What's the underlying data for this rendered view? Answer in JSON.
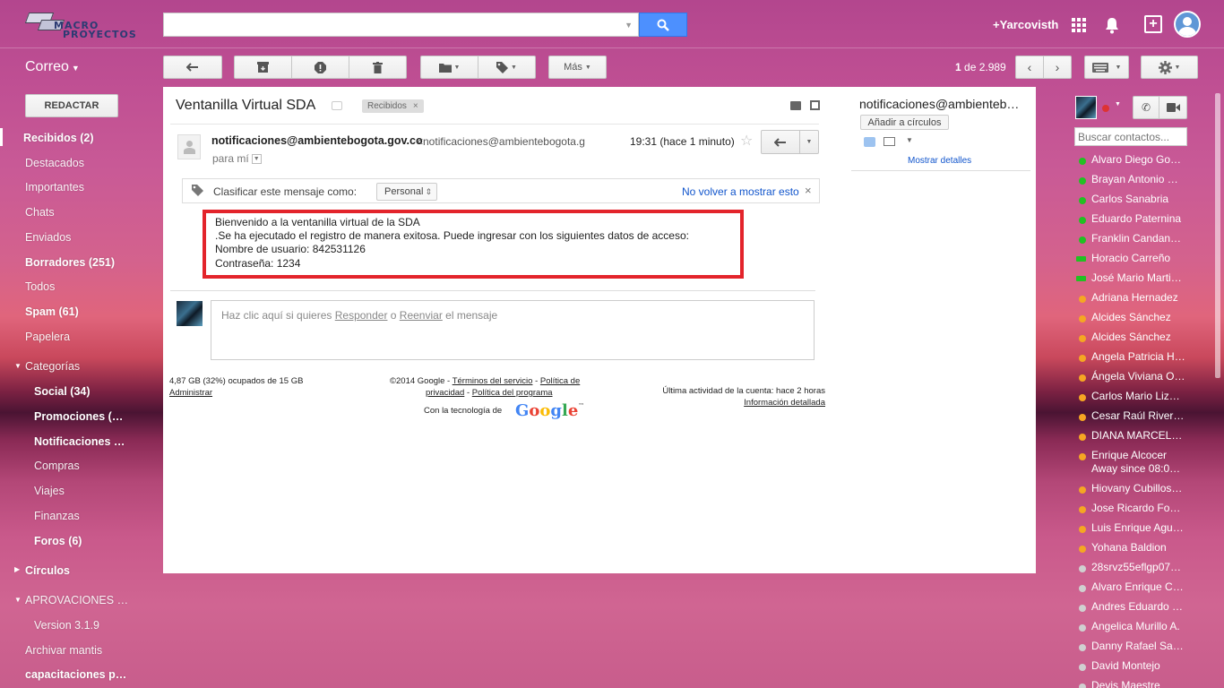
{
  "header": {
    "logo_line1": "MACRO",
    "logo_line2": "PROYECTOS",
    "search_value": "",
    "user_name": "+Yarcovisth"
  },
  "toolbar": {
    "app_label": "Correo",
    "more_label": "Más",
    "count_prefix": "1",
    "count_suffix": " de 2.989"
  },
  "nav": {
    "compose": "REDACTAR",
    "items": {
      "inbox": "Recibidos (2)",
      "starred": "Destacados",
      "important": "Importantes",
      "chats": "Chats",
      "sent": "Enviados",
      "drafts": "Borradores (251)",
      "all": "Todos",
      "spam": "Spam (61)",
      "trash": "Papelera",
      "categories": "Categorías",
      "social": "Social (34)",
      "promotions": "Promociones (…",
      "notifications": "Notificaciones …",
      "shopping": "Compras",
      "travel": "Viajes",
      "finance": "Finanzas",
      "forums": "Foros (6)",
      "circles": "Círculos",
      "aprovaciones": "APROVACIONES …",
      "version": "Version 3.1.9",
      "archivar": "Archivar mantis",
      "capacitaciones": "capacitaciones p…"
    }
  },
  "message": {
    "subject": "Ventanilla Virtual SDA",
    "label": "Recibidos",
    "sender_name": "notificaciones@ambientebogota.gov.co",
    "sender_email": "<notificaciones@ambientebogota.g",
    "to": "para mí",
    "time": "19:31 (hace 1 minuto)",
    "classify_text": "Clasificar este mensaje como:",
    "classify_value": "Personal",
    "classify_dismiss": "No volver a mostrar esto",
    "body": {
      "line1": "Bienvenido a la ventanilla virtual de la SDA",
      "line2": ".Se ha ejecutado el registro de manera exitosa. Puede ingresar con los siguientes datos de acceso:",
      "line3": "Nombre de usuario: 842531126",
      "line4": "Contraseña: 1234"
    },
    "reply_prompt_pre": "Haz clic aquí si quieres ",
    "reply_link": "Responder",
    "reply_mid": " o ",
    "forward_link": "Reenviar",
    "reply_post": " el mensaje"
  },
  "footer": {
    "storage": "4,87 GB (32%) ocupados de 15 GB",
    "manage": "Administrar",
    "copyright": "©2014 Google - ",
    "terms": "Términos del servicio",
    "sep1": " - ",
    "privacy1": "Política de",
    "privacy2": "privacidad",
    "sep2": " - ",
    "program_policy": "Política del programa",
    "powered": "Con la tecnología de",
    "google": "Google",
    "activity": "Última actividad de la cuenta: hace 2 horas",
    "details": "Información detallada"
  },
  "contact_panel": {
    "email": "notificaciones@ambientebo…",
    "add_circles": "Añadir a círculos",
    "show_details": "Mostrar detalles"
  },
  "chat": {
    "search_placeholder": "Buscar contactos...",
    "colors": {
      "green": "#22c022",
      "orange": "#f5a623",
      "gray": "#d0d0d0"
    },
    "contacts": [
      {
        "name": "Alvaro Diego Go…",
        "status": "green"
      },
      {
        "name": "Brayan Antonio G…",
        "status": "green"
      },
      {
        "name": "Carlos Sanabria",
        "status": "green"
      },
      {
        "name": "Eduardo Paternina",
        "status": "green"
      },
      {
        "name": "Franklin Candan…",
        "status": "green"
      },
      {
        "name": "Horacio Carreño",
        "status": "green-mobile"
      },
      {
        "name": "José Mario Marti…",
        "status": "green-mobile"
      },
      {
        "name": "Adriana Hernadez",
        "status": "orange"
      },
      {
        "name": "Alcides Sánchez",
        "status": "orange"
      },
      {
        "name": "Alcides Sánchez",
        "status": "orange"
      },
      {
        "name": "Angela Patricia H…",
        "status": "orange"
      },
      {
        "name": "Ángela Viviana O…",
        "status": "orange"
      },
      {
        "name": "Carlos Mario Liz…",
        "status": "orange"
      },
      {
        "name": "Cesar Raúl River…",
        "status": "orange"
      },
      {
        "name": "DIANA MARCELA…",
        "status": "orange"
      },
      {
        "name": "Enrique Alcocer",
        "sub": "Away since 08:0…",
        "status": "orange"
      },
      {
        "name": "Hiovany Cubillos…",
        "status": "orange"
      },
      {
        "name": "Jose Ricardo Fo…",
        "status": "orange"
      },
      {
        "name": "Luis Enrique Agu…",
        "status": "orange"
      },
      {
        "name": "Yohana Baldion",
        "status": "orange"
      },
      {
        "name": "28srvz55eflgp07…",
        "status": "gray"
      },
      {
        "name": "Alvaro Enrique C…",
        "status": "gray"
      },
      {
        "name": "Andres Eduardo …",
        "status": "gray"
      },
      {
        "name": "Angelica Murillo A.",
        "status": "gray"
      },
      {
        "name": "Danny Rafael Sa…",
        "status": "gray"
      },
      {
        "name": "David Montejo",
        "status": "gray"
      },
      {
        "name": "Devis Maestre",
        "status": "gray"
      }
    ]
  }
}
